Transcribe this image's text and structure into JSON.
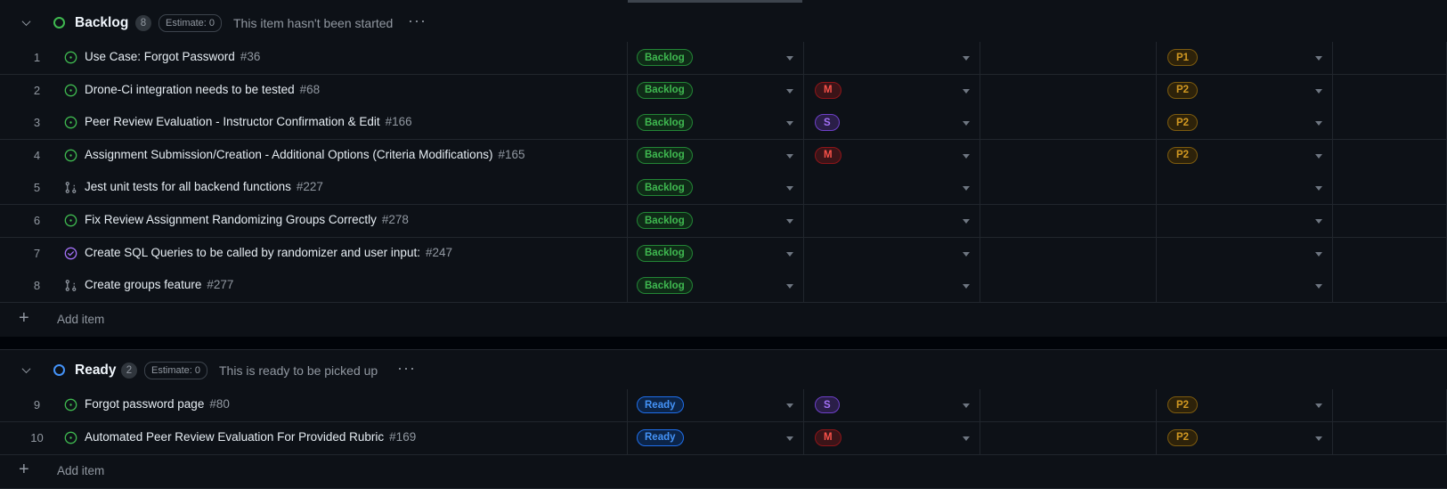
{
  "groups": [
    {
      "title": "Backlog",
      "count": "8",
      "estimate": "Estimate: 0",
      "description": "This item hasn't been started",
      "more": "···",
      "color": "#3fb950",
      "add_label": "Add item",
      "rows": [
        {
          "num": "1",
          "icon": "open-issue-icon",
          "title": "Use Case: Forgot Password",
          "issue": "#36",
          "status": "Backlog",
          "size": "",
          "priority": "P1"
        },
        {
          "num": "2",
          "icon": "open-issue-icon",
          "title": "Drone-Ci integration needs to be tested",
          "issue": "#68",
          "status": "Backlog",
          "size": "M",
          "priority": "P2"
        },
        {
          "num": "3",
          "icon": "open-issue-icon",
          "title": "Peer Review Evaluation - Instructor Confirmation & Edit",
          "issue": "#166",
          "status": "Backlog",
          "size": "S",
          "priority": "P2"
        },
        {
          "num": "4",
          "icon": "open-issue-icon",
          "title": "Assignment Submission/Creation - Additional Options (Criteria Modifications)",
          "issue": "#165",
          "status": "Backlog",
          "size": "M",
          "priority": "P2"
        },
        {
          "num": "5",
          "icon": "pull-request-icon",
          "title": "Jest unit tests for all backend functions",
          "issue": "#227",
          "status": "Backlog",
          "size": "",
          "priority": ""
        },
        {
          "num": "6",
          "icon": "open-issue-icon",
          "title": "Fix Review Assignment Randomizing Groups Correctly",
          "issue": "#278",
          "status": "Backlog",
          "size": "",
          "priority": ""
        },
        {
          "num": "7",
          "icon": "closed-issue-icon",
          "title": "Create SQL Queries to be called by randomizer and user input:",
          "issue": "#247",
          "status": "Backlog",
          "size": "",
          "priority": ""
        },
        {
          "num": "8",
          "icon": "pull-request-icon",
          "title": "Create groups feature",
          "issue": "#277",
          "status": "Backlog",
          "size": "",
          "priority": ""
        }
      ]
    },
    {
      "title": "Ready",
      "count": "2",
      "estimate": "Estimate: 0",
      "description": "This is ready to be picked up",
      "more": "···",
      "color": "#4493f8",
      "add_label": "Add item",
      "rows": [
        {
          "num": "9",
          "icon": "open-issue-icon",
          "title": "Forgot password page",
          "issue": "#80",
          "status": "Ready",
          "size": "S",
          "priority": "P2"
        },
        {
          "num": "10",
          "icon": "open-issue-icon",
          "title": "Automated Peer Review Evaluation For Provided Rubric",
          "issue": "#169",
          "status": "Ready",
          "size": "M",
          "priority": "P2"
        }
      ]
    }
  ],
  "icons": {
    "collapse": "chevron-down-icon",
    "add": "plus-icon"
  }
}
